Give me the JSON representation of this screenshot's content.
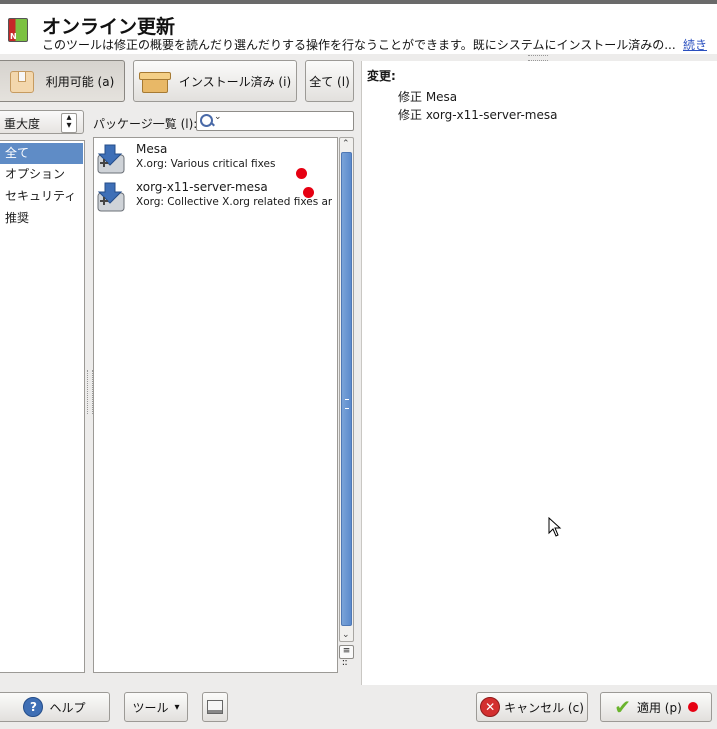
{
  "header": {
    "title": "オンライン更新",
    "subtitle": "このツールは修正の概要を読んだり選んだりする操作を行なうことができます。既にシステムにインストール済みの...",
    "more_link": "続き"
  },
  "filter_buttons": {
    "available": "利用可能 (a)",
    "installed": "インストール済み (i)",
    "all": "全て (l)"
  },
  "left": {
    "combo_value": "重大度",
    "categories": [
      "全て",
      "オプション",
      "セキュリティ",
      "推奨"
    ]
  },
  "packages": {
    "label": "パッケージ一覧 (l):",
    "items": [
      {
        "name": "Mesa",
        "desc": "X.org: Various critical fixes"
      },
      {
        "name": "xorg-x11-server-mesa",
        "desc": "Xorg:  Collective X.org related fixes an…"
      }
    ]
  },
  "details": {
    "heading": "変更:",
    "lines": [
      "修正 Mesa",
      "修正 xorg-x11-server-mesa"
    ]
  },
  "bottom": {
    "help": "ヘルプ",
    "tools": "ツール",
    "cancel": "キャンセル (c)",
    "apply": "適用 (p)"
  },
  "colors": {
    "selection": "#5f8cc6",
    "scroll_thumb": "#6a96d2",
    "status_dot": "#e60012",
    "link": "#2a4fbf"
  }
}
